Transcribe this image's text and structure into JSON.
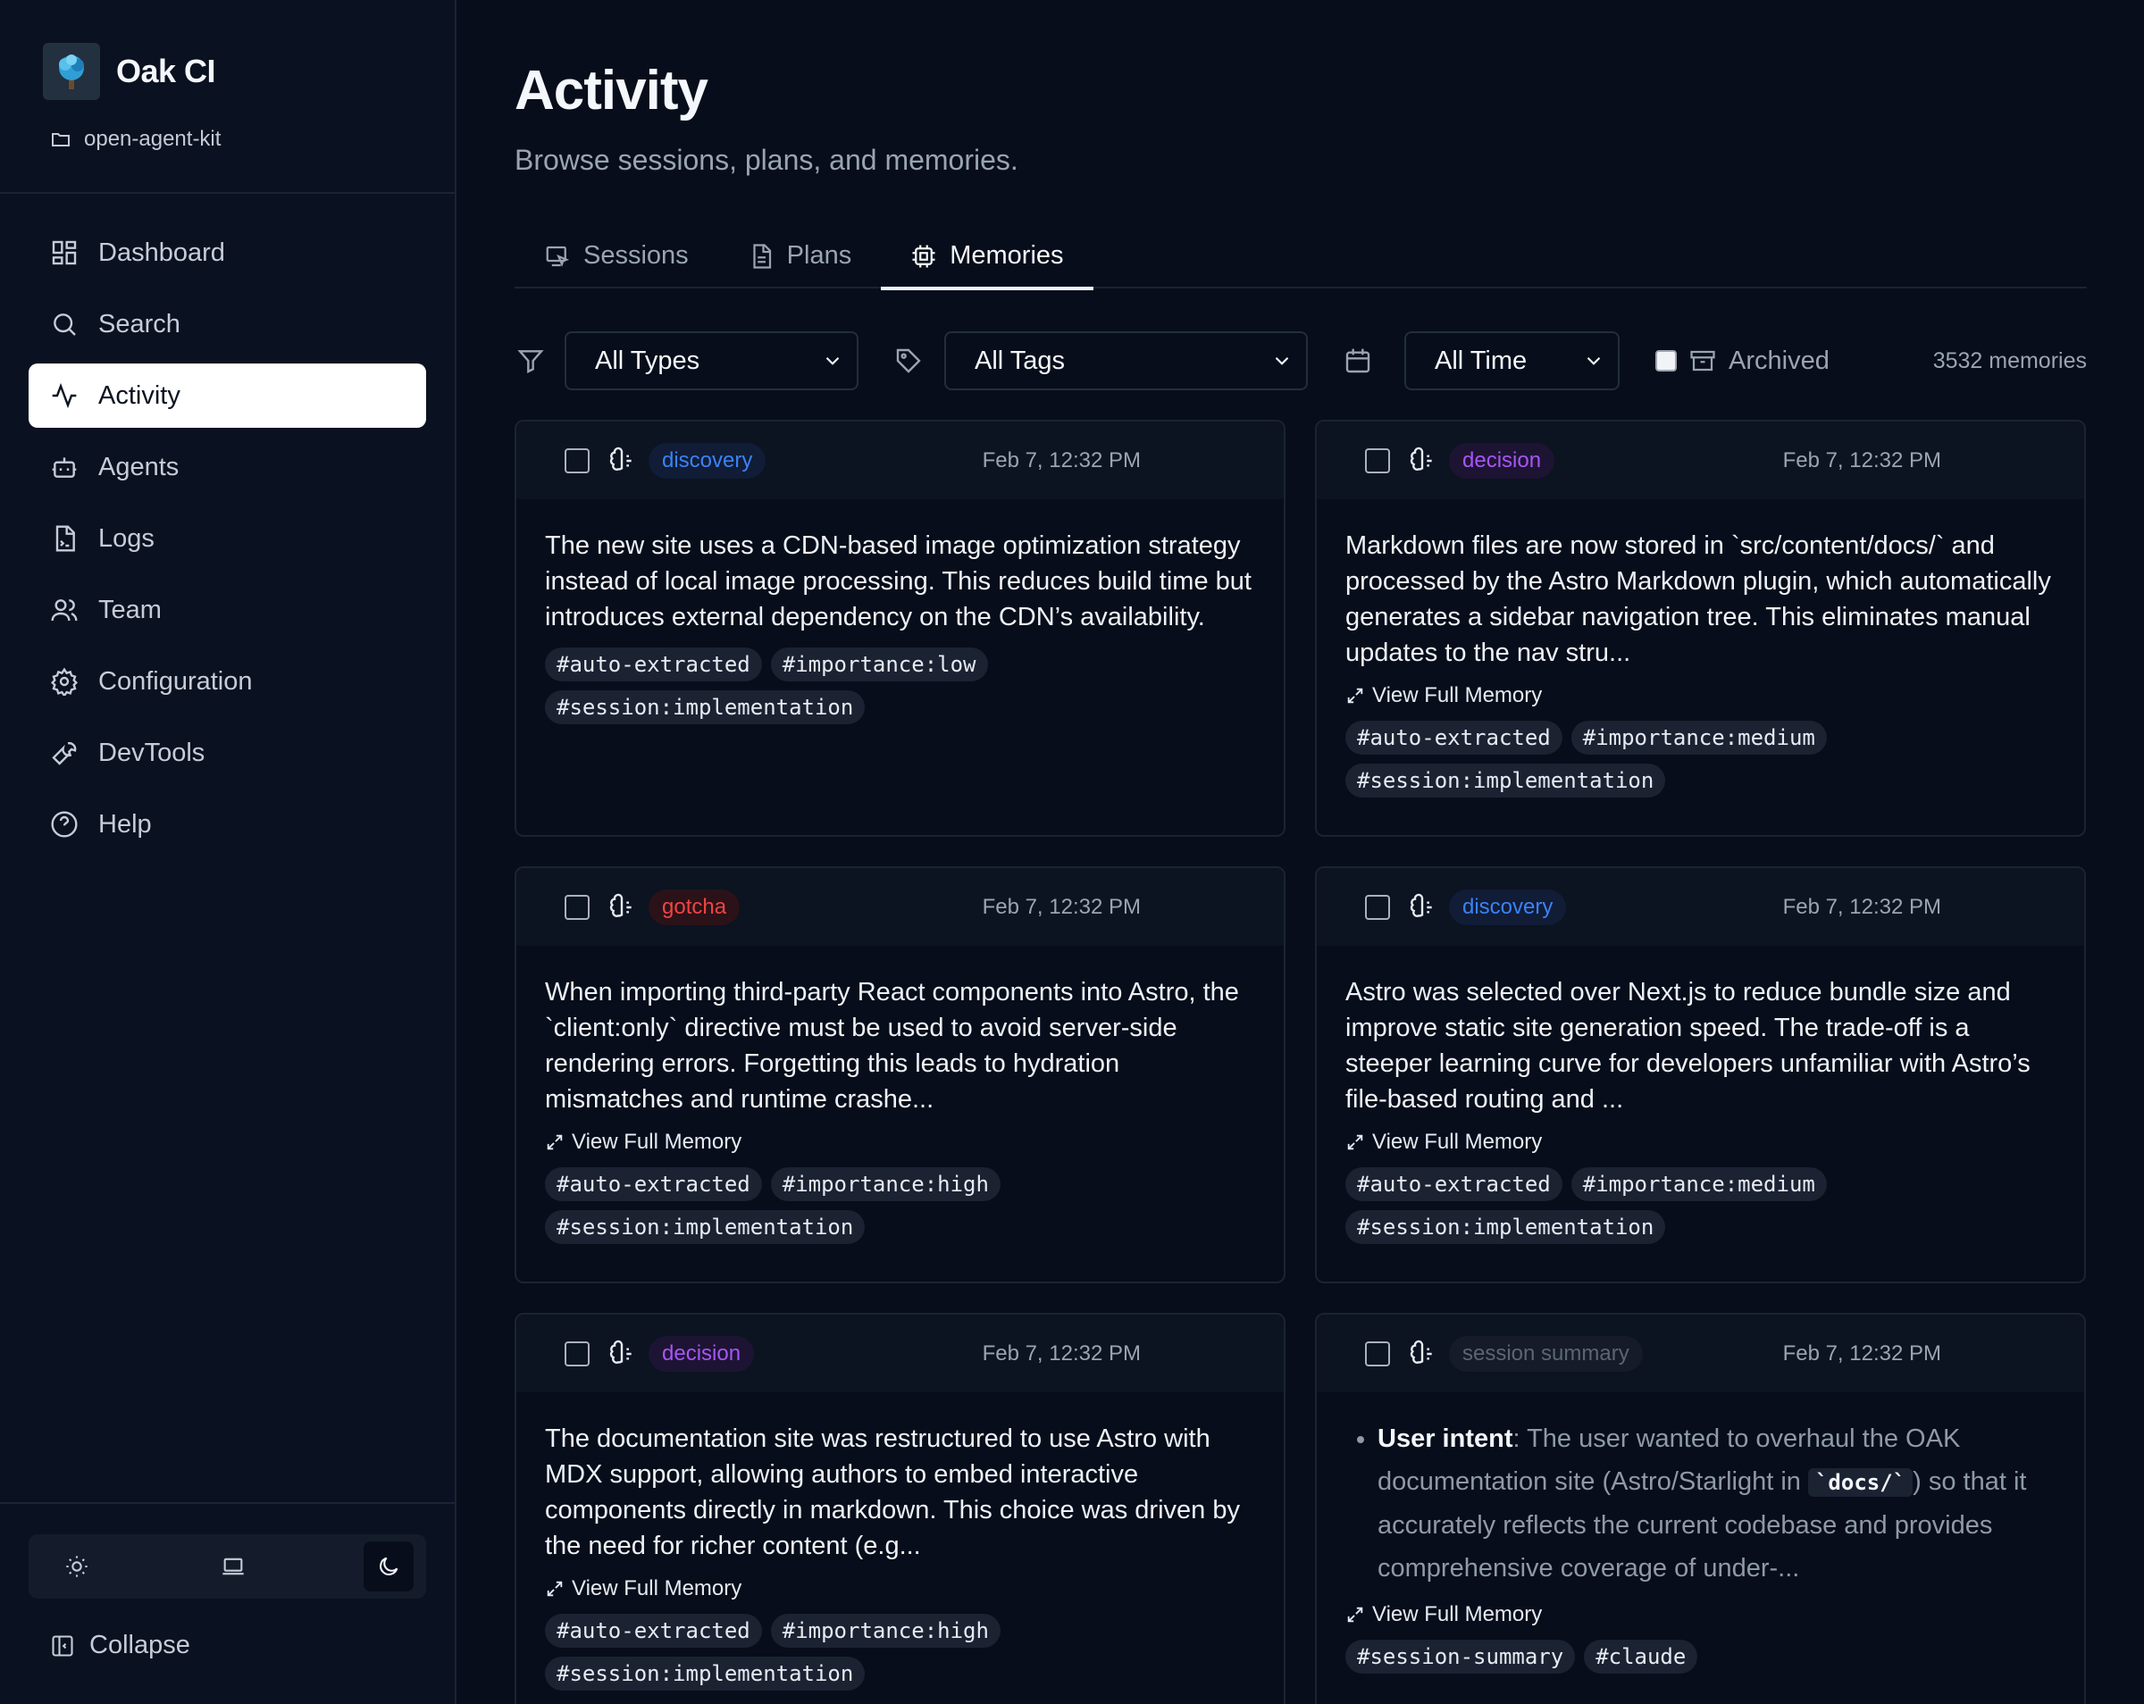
{
  "sidebar": {
    "brand": "Oak CI",
    "project": "open-agent-kit",
    "items": [
      {
        "label": "Dashboard",
        "icon": "dashboard-icon",
        "active": false
      },
      {
        "label": "Search",
        "icon": "search-icon",
        "active": false
      },
      {
        "label": "Activity",
        "icon": "activity-icon",
        "active": true
      },
      {
        "label": "Agents",
        "icon": "bot-icon",
        "active": false
      },
      {
        "label": "Logs",
        "icon": "file-icon",
        "active": false
      },
      {
        "label": "Team",
        "icon": "users-icon",
        "active": false
      },
      {
        "label": "Configuration",
        "icon": "gear-icon",
        "active": false
      },
      {
        "label": "DevTools",
        "icon": "wrench-icon",
        "active": false
      },
      {
        "label": "Help",
        "icon": "help-icon",
        "active": false
      }
    ],
    "theme": {
      "options": [
        "light",
        "system",
        "dark"
      ],
      "selected": "dark"
    },
    "collapse_label": "Collapse"
  },
  "header": {
    "title": "Activity",
    "subtitle": "Browse sessions, plans, and memories."
  },
  "tabs": [
    {
      "label": "Sessions",
      "icon": "sessions-icon",
      "active": false
    },
    {
      "label": "Plans",
      "icon": "document-icon",
      "active": false
    },
    {
      "label": "Memories",
      "icon": "chip-icon",
      "active": true
    }
  ],
  "filters": {
    "type": "All Types",
    "tags": "All Tags",
    "time": "All Time",
    "archived_label": "Archived",
    "count": "3532 memories"
  },
  "memories": [
    {
      "type": "discovery",
      "time": "Feb 7, 12:32 PM",
      "text": "The new site uses a CDN-based image optimization strategy instead of local image processing. This reduces build time but introduces external dependency on the CDN’s availability.",
      "view_full": "",
      "tags": [
        "#auto-extracted",
        "#importance:low",
        "#session:implementation"
      ]
    },
    {
      "type": "decision",
      "time": "Feb 7, 12:32 PM",
      "text": "Markdown files are now stored in `src/content/docs/` and processed by the Astro Markdown plugin, which automatically generates a sidebar navigation tree. This eliminates manual updates to the nav stru...",
      "view_full": "View Full Memory",
      "tags": [
        "#auto-extracted",
        "#importance:medium",
        "#session:implementation"
      ]
    },
    {
      "type": "gotcha",
      "time": "Feb 7, 12:32 PM",
      "text": "When importing third-party React components into Astro, the `client:only` directive must be used to avoid server-side rendering errors. Forgetting this leads to hydration mismatches and runtime crashe...",
      "view_full": "View Full Memory",
      "tags": [
        "#auto-extracted",
        "#importance:high",
        "#session:implementation"
      ]
    },
    {
      "type": "discovery",
      "time": "Feb 7, 12:32 PM",
      "text": "Astro was selected over Next.js to reduce bundle size and improve static site generation speed. The trade-off is a steeper learning curve for developers unfamiliar with Astro’s file-based routing and ...",
      "view_full": "View Full Memory",
      "tags": [
        "#auto-extracted",
        "#importance:medium",
        "#session:implementation"
      ]
    },
    {
      "type": "decision",
      "time": "Feb 7, 12:32 PM",
      "text": "The documentation site was restructured to use Astro with MDX support, allowing authors to embed interactive components directly in markdown. This choice was driven by the need for richer content (e.g...",
      "view_full": "View Full Memory",
      "tags": [
        "#auto-extracted",
        "#importance:high",
        "#session:implementation"
      ]
    },
    {
      "type": "session summary",
      "time": "Feb 7, 12:32 PM",
      "summary_label": "User intent",
      "summary_before": ": The user wanted to overhaul the OAK documentation site (Astro/Starlight in ",
      "summary_code": "`docs/`",
      "summary_after": ") so that it accurately reflects the current codebase and provides comprehensive coverage of under-...",
      "view_full": "View Full Memory",
      "tags": [
        "#session-summary",
        "#claude"
      ]
    }
  ],
  "colors": {
    "background": "#070d1a",
    "discovery": "#3b82f6",
    "decision": "#a855f7",
    "gotcha": "#ef4444",
    "summary": "#5b6575"
  }
}
